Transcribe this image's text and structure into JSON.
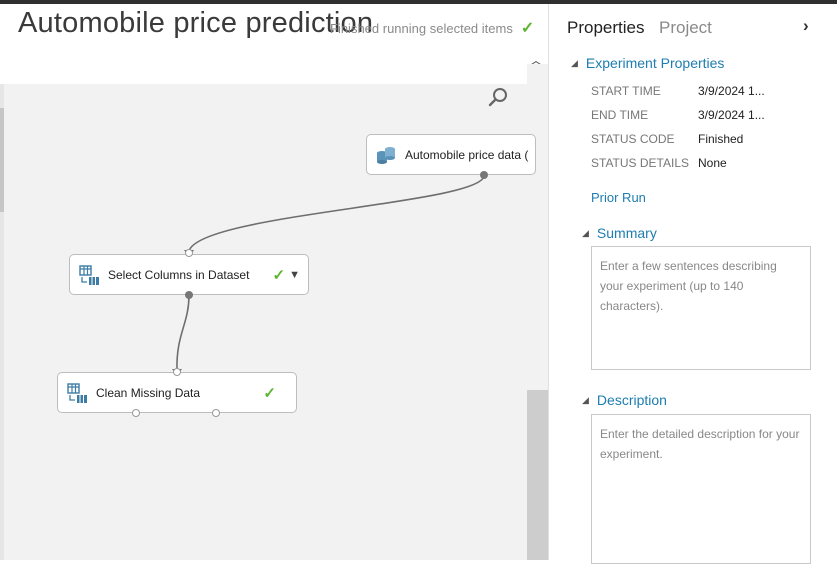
{
  "experiment": {
    "title": "Automobile price prediction",
    "run_status": "Finished running selected items"
  },
  "modules": [
    {
      "label": "Automobile price data (",
      "icon": "dataset-icon",
      "status": ""
    },
    {
      "label": "Select Columns in Dataset",
      "icon": "table-transform-icon",
      "status": "finished"
    },
    {
      "label": "Clean Missing Data",
      "icon": "table-transform-icon",
      "status": "finished"
    }
  ],
  "panel": {
    "tabs": [
      "Properties",
      "Project"
    ],
    "experiment_properties": {
      "heading": "Experiment Properties",
      "rows": [
        {
          "key": "START TIME",
          "value": "3/9/2024 1..."
        },
        {
          "key": "END TIME",
          "value": "3/9/2024 1..."
        },
        {
          "key": "STATUS CODE",
          "value": "Finished"
        },
        {
          "key": "STATUS DETAILS",
          "value": "None"
        }
      ]
    },
    "prior_run": "Prior Run",
    "summary": {
      "heading": "Summary",
      "placeholder": "Enter a few sentences describing your experiment (up to 140 characters)."
    },
    "description": {
      "heading": "Description",
      "placeholder": "Enter the detailed description for your experiment."
    }
  },
  "colors": {
    "accent": "#1e7db0",
    "success": "#5cb531"
  }
}
